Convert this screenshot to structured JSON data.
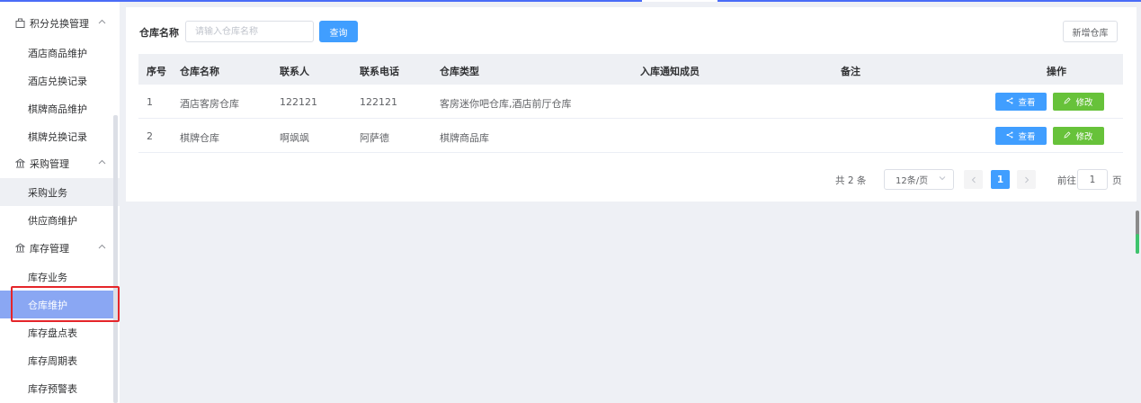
{
  "sidebar": {
    "groups": [
      {
        "label": "积分兑换管理",
        "icon": "gift-icon"
      },
      {
        "label": "采购管理",
        "icon": "bank-icon"
      },
      {
        "label": "库存管理",
        "icon": "bank-icon"
      }
    ],
    "items": [
      {
        "label": "酒店商品维护"
      },
      {
        "label": "酒店兑换记录"
      },
      {
        "label": "棋牌商品维护"
      },
      {
        "label": "棋牌兑换记录"
      },
      {
        "label": "采购业务"
      },
      {
        "label": "供应商维护"
      },
      {
        "label": "库存业务"
      },
      {
        "label": "仓库维护"
      },
      {
        "label": "库存盘点表"
      },
      {
        "label": "库存周期表"
      },
      {
        "label": "库存预警表"
      }
    ],
    "active_item": "仓库维护"
  },
  "search": {
    "label": "仓库名称",
    "placeholder": "请输入仓库名称",
    "query_button": "查询",
    "new_button": "新增仓库"
  },
  "table": {
    "headers": {
      "index": "序号",
      "name": "仓库名称",
      "contact": "联系人",
      "phone": "联系电话",
      "type": "仓库类型",
      "notify": "入库通知成员",
      "remark": "备注",
      "actions": "操作"
    },
    "rows": [
      {
        "index": "1",
        "name": "酒店客房仓库",
        "contact": "122121",
        "phone": "122121",
        "type": "客房迷你吧仓库,酒店前厅仓库",
        "notify": "",
        "remark": ""
      },
      {
        "index": "2",
        "name": "棋牌仓库",
        "contact": "啊飒飒",
        "phone": "阿萨德",
        "type": "棋牌商品库",
        "notify": "",
        "remark": ""
      }
    ],
    "view_label": "查看",
    "edit_label": "修改"
  },
  "pagination": {
    "total": "共 2 条",
    "page_size": "12条/页",
    "current_page": "1",
    "goto_prefix": "前往",
    "goto_value": "1",
    "goto_suffix": "页"
  },
  "colors": {
    "primary": "#409eff",
    "success": "#67c23a",
    "active_menu": "#8aa7f3",
    "highlight_box": "#e5252a"
  }
}
